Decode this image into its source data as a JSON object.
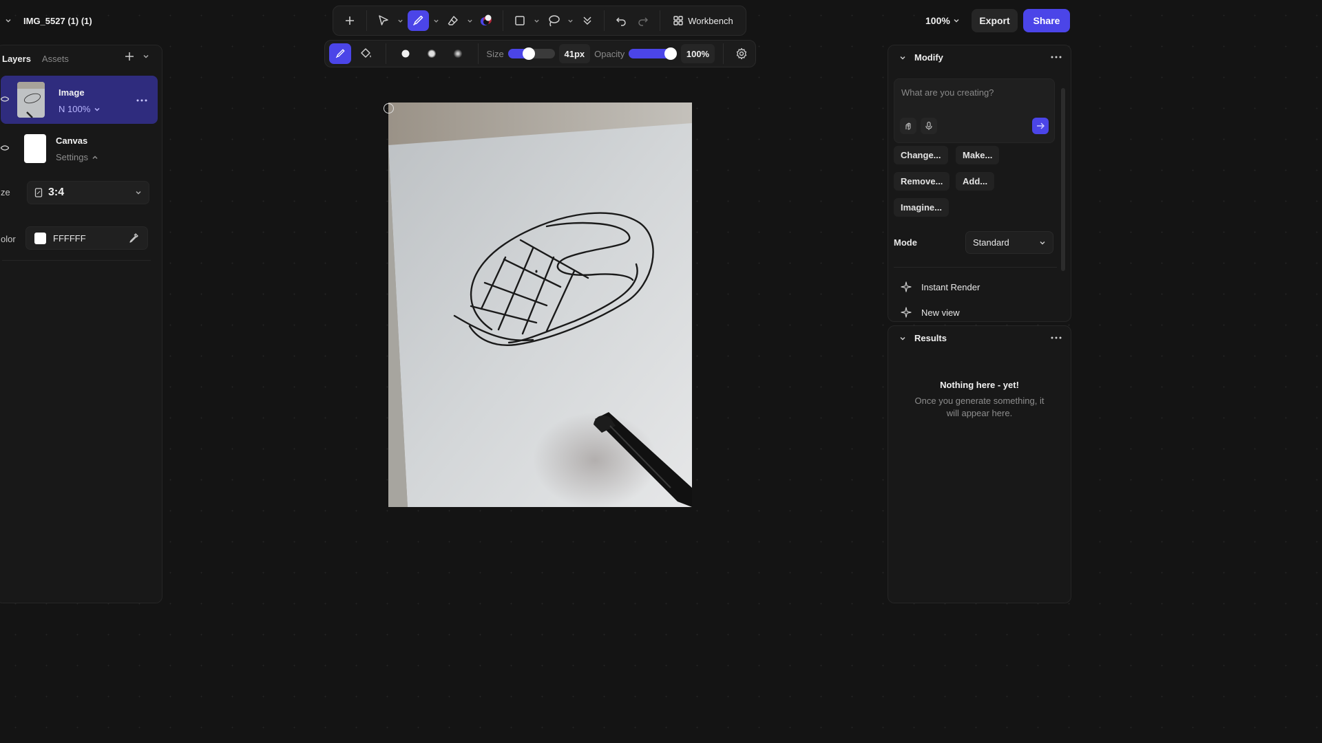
{
  "header": {
    "file_title": "IMG_5527 (1) (1)",
    "zoom": "100%",
    "export_label": "Export",
    "share_label": "Share",
    "workbench_label": "Workbench"
  },
  "toolbar": {
    "tools": [
      "add-icon",
      "select-arrow-icon",
      "brush-icon",
      "eraser-icon",
      "color-blob-icon",
      "rectangle-icon",
      "lasso-icon",
      "double-chevron-down-icon",
      "undo-icon",
      "redo-icon"
    ],
    "active_tool": "brush"
  },
  "brush": {
    "size_label": "Size",
    "size_value": "41px",
    "size_level": 0.41,
    "opacity_label": "Opacity",
    "opacity_value": "100%",
    "opacity_level": 1.0
  },
  "left_panel": {
    "tabs": [
      "Layers",
      "Assets"
    ],
    "layers": [
      {
        "name": "Image",
        "sub": "N 100%"
      },
      {
        "name": "Canvas",
        "sub": "Settings"
      }
    ],
    "size_label": "ze",
    "size_value": "3:4",
    "color_label": "olor",
    "color_value": "FFFFFF"
  },
  "modify": {
    "title": "Modify",
    "prompt_placeholder": "What are you creating?",
    "chips": [
      "Change...",
      "Make...",
      "Remove...",
      "Add...",
      "Imagine..."
    ],
    "mode_label": "Mode",
    "mode_value": "Standard",
    "instant_render": "Instant Render",
    "partial_item": "New view"
  },
  "results": {
    "title": "Results",
    "empty_title": "Nothing here - yet!",
    "empty_desc": "Once you generate something, it will appear here."
  },
  "colors": {
    "accent": "#4b45e8",
    "background": "#141414",
    "panel": "#181818"
  }
}
